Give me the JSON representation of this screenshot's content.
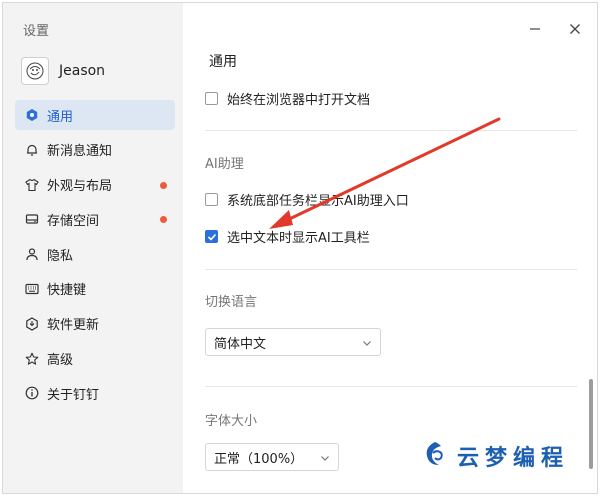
{
  "sidebar": {
    "title": "设置",
    "username": "Jeason",
    "items": [
      {
        "label": "通用",
        "icon": "general-icon",
        "active": true,
        "dot": false
      },
      {
        "label": "新消息通知",
        "icon": "bell-icon",
        "active": false,
        "dot": false
      },
      {
        "label": "外观与布局",
        "icon": "shirt-icon",
        "active": false,
        "dot": true
      },
      {
        "label": "存储空间",
        "icon": "storage-icon",
        "active": false,
        "dot": true
      },
      {
        "label": "隐私",
        "icon": "person-icon",
        "active": false,
        "dot": false
      },
      {
        "label": "快捷键",
        "icon": "keyboard-icon",
        "active": false,
        "dot": false
      },
      {
        "label": "软件更新",
        "icon": "update-icon",
        "active": false,
        "dot": false
      },
      {
        "label": "高级",
        "icon": "star-icon",
        "active": false,
        "dot": false
      },
      {
        "label": "关于钉钉",
        "icon": "info-icon",
        "active": false,
        "dot": false
      }
    ]
  },
  "main": {
    "section_title": "通用",
    "open_in_browser": {
      "label": "始终在浏览器中打开文档",
      "checked": false
    },
    "ai": {
      "heading": "AI助理",
      "taskbar": {
        "label": "系统底部任务栏显示AI助理入口",
        "checked": false
      },
      "toolbar": {
        "label": "选中文本时显示AI工具栏",
        "checked": true
      }
    },
    "language": {
      "heading": "切换语言",
      "value": "简体中文"
    },
    "font_size": {
      "heading": "字体大小",
      "value": "正常（100%）"
    }
  },
  "watermark": {
    "text": "云梦编程"
  },
  "colors": {
    "accent": "#2c6fdc",
    "arrow": "#e23a2a",
    "dot": "#ee5a3c",
    "active_bg": "#dde7f4"
  }
}
